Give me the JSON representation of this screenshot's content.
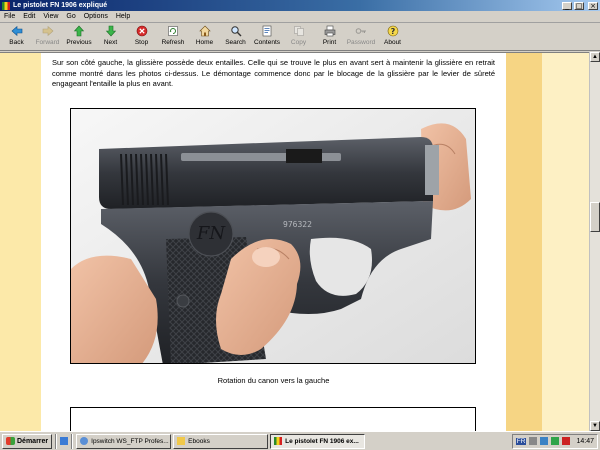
{
  "window": {
    "title": "Le pistolet FN 1906 expliqué",
    "controls": {
      "minimize": "_",
      "maximize": "□",
      "close": "×"
    }
  },
  "menu": [
    "File",
    "Edit",
    "View",
    "Go",
    "Options",
    "Help"
  ],
  "toolbar": [
    {
      "label": "Back",
      "icon": "back-arrow-icon",
      "enabled": true
    },
    {
      "label": "Forward",
      "icon": "forward-arrow-icon",
      "enabled": false
    },
    {
      "label": "Previous",
      "icon": "up-arrow-icon",
      "enabled": true
    },
    {
      "label": "Next",
      "icon": "down-arrow-icon",
      "enabled": true
    },
    {
      "label": "Stop",
      "icon": "stop-icon",
      "enabled": true
    },
    {
      "label": "Refresh",
      "icon": "refresh-icon",
      "enabled": true
    },
    {
      "label": "Home",
      "icon": "home-icon",
      "enabled": true
    },
    {
      "label": "Search",
      "icon": "search-icon",
      "enabled": true
    },
    {
      "label": "Contents",
      "icon": "contents-icon",
      "enabled": true
    },
    {
      "label": "Copy",
      "icon": "copy-icon",
      "enabled": false
    },
    {
      "label": "Print",
      "icon": "print-icon",
      "enabled": true
    },
    {
      "label": "Password",
      "icon": "key-icon",
      "enabled": false
    },
    {
      "label": "About",
      "icon": "about-icon",
      "enabled": true
    }
  ],
  "content": {
    "paragraph": "Sur son côté gauche, la glissière possède deux entailles. Celle qui se trouve le plus en avant sert à maintenir la glissière en retrait comme montré dans les photos ci-dessus. Le démontage commence donc par le blocage de la glissière par le levier de sûreté engageant l'entaille la plus en avant.",
    "photo_serial": "976322",
    "caption": "Rotation du canon vers la gauche"
  },
  "taskbar": {
    "start_label": "Démarrer",
    "tasks": [
      {
        "label": "Ipswitch WS_FTP Profes...",
        "active": false
      },
      {
        "label": "Ebooks",
        "active": false
      },
      {
        "label": "Le pistolet FN 1906 ex...",
        "active": true
      }
    ],
    "language": "FR",
    "clock": "14:47"
  },
  "colors": {
    "title_bar": "#0a246a",
    "page_bg": "#ffffff",
    "left_band": "#fce9a9",
    "right_band": "#f6d584"
  }
}
